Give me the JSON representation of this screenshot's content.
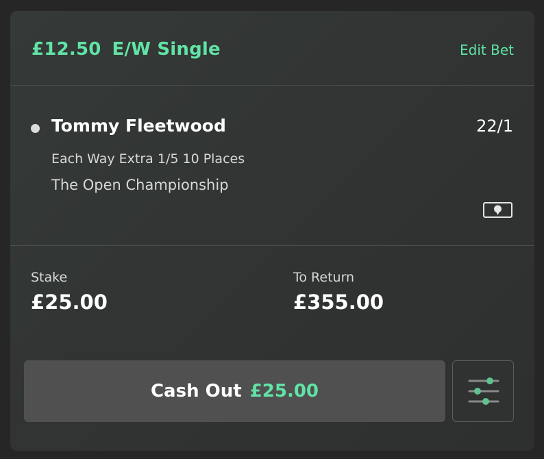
{
  "bet": {
    "header_stake": "£12.50",
    "header_type": "E/W Single",
    "edit_label": "Edit Bet"
  },
  "selection": {
    "runner": "Tommy Fleetwood",
    "odds": "22/1",
    "market": "Each Way Extra 1/5 10 Places",
    "event": "The Open Championship",
    "icon": "live-stream-icon"
  },
  "summary": {
    "stake_label": "Stake",
    "stake_value": "£25.00",
    "return_label": "To Return",
    "return_value": "£355.00"
  },
  "cashout": {
    "label": "Cash Out",
    "amount": "£25.00",
    "settings_icon": "sliders-icon"
  },
  "colors": {
    "accent": "#61e3a6",
    "card_bg": "#333735",
    "button_bg": "#505050",
    "page_bg": "#262626"
  }
}
